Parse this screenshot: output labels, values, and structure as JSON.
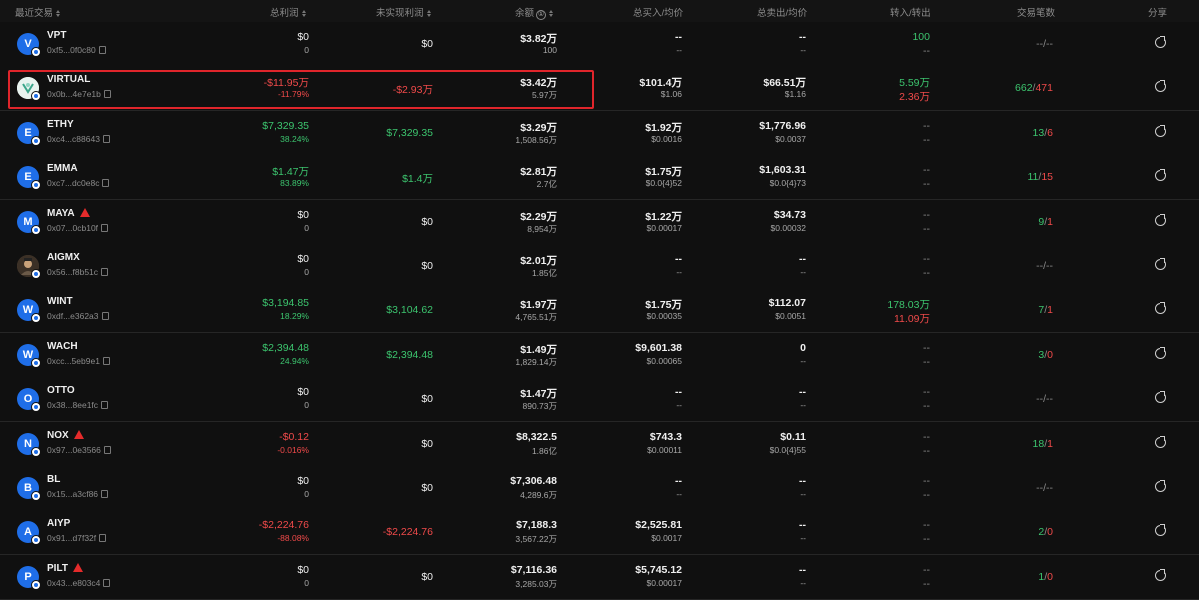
{
  "headers": {
    "recent": "最近交易",
    "total_pnl": "总利润",
    "unrealized": "未实现利润",
    "balance": "余额",
    "buy": "总买入/均价",
    "sell": "总卖出/均价",
    "transfer": "转入/转出",
    "tx_count": "交易笔数",
    "share": "分享"
  },
  "info_glyph": "①",
  "rows": [
    {
      "avatar": "V",
      "avatar_color": "#1f6ee8",
      "name": "VPT",
      "addr": "0xf5...0f0c80",
      "warn": false,
      "pnl": "$0",
      "pnl_pct": "0",
      "pnl_color": "neutral",
      "unreal": "$0",
      "unreal_color": "neutral",
      "bal": "$3.82万",
      "bal_sub": "100",
      "buy": "--",
      "buy_sub": "--",
      "sell": "--",
      "sell_sub": "--",
      "tin": "100",
      "tin_color": "green",
      "tout": "--",
      "tout_color": "dim",
      "tx_a": "--",
      "tx_sep": "/",
      "tx_b": "--",
      "tx_color": "dim"
    },
    {
      "avatar": "",
      "avatar_color": "#e8f3ef",
      "name": "VIRTUAL",
      "addr": "0x0b...4e7e1b",
      "warn": false,
      "pnl": "-$11.95万",
      "pnl_pct": "-11.79%",
      "pnl_color": "red",
      "unreal": "-$2.93万",
      "unreal_color": "red",
      "bal": "$3.42万",
      "bal_sub": "5.97万",
      "buy": "$101.4万",
      "buy_sub": "$1.06",
      "sell": "$66.51万",
      "sell_sub": "$1.16",
      "tin": "5.59万",
      "tin_color": "green",
      "tout": "2.36万",
      "tout_color": "red",
      "tx_a": "662",
      "tx_sep": "/",
      "tx_b": "471",
      "tx_color": "mixed"
    },
    {
      "avatar": "E",
      "avatar_color": "#1f6ee8",
      "name": "ETHY",
      "addr": "0xc4...c88643",
      "warn": false,
      "pnl": "$7,329.35",
      "pnl_pct": "38.24%",
      "pnl_color": "green",
      "unreal": "$7,329.35",
      "unreal_color": "green",
      "bal": "$3.29万",
      "bal_sub": "1,508.56万",
      "buy": "$1.92万",
      "buy_sub": "$0.0016",
      "sell": "$1,776.96",
      "sell_sub": "$0.0037",
      "tin": "--",
      "tin_color": "dim",
      "tout": "--",
      "tout_color": "dim",
      "tx_a": "13",
      "tx_sep": "/",
      "tx_b": "6",
      "tx_color": "mixed"
    },
    {
      "avatar": "E",
      "avatar_color": "#1f6ee8",
      "name": "EMMA",
      "addr": "0xc7...dc0e8c",
      "warn": false,
      "pnl": "$1.47万",
      "pnl_pct": "83.89%",
      "pnl_color": "green",
      "unreal": "$1.4万",
      "unreal_color": "green",
      "bal": "$2.81万",
      "bal_sub": "2.7亿",
      "buy": "$1.75万",
      "buy_sub": "$0.0{4}52",
      "sell": "$1,603.31",
      "sell_sub": "$0.0{4}73",
      "tin": "--",
      "tin_color": "dim",
      "tout": "--",
      "tout_color": "dim",
      "tx_a": "11",
      "tx_sep": "/",
      "tx_b": "15",
      "tx_color": "mixed"
    },
    {
      "avatar": "M",
      "avatar_color": "#1f6ee8",
      "name": "MAYA",
      "addr": "0x07...0cb10f",
      "warn": true,
      "pnl": "$0",
      "pnl_pct": "0",
      "pnl_color": "neutral",
      "unreal": "$0",
      "unreal_color": "neutral",
      "bal": "$2.29万",
      "bal_sub": "8,954万",
      "buy": "$1.22万",
      "buy_sub": "$0.00017",
      "sell": "$34.73",
      "sell_sub": "$0.00032",
      "tin": "--",
      "tin_color": "dim",
      "tout": "--",
      "tout_color": "dim",
      "tx_a": "9",
      "tx_sep": "/",
      "tx_b": "1",
      "tx_color": "mixed"
    },
    {
      "avatar": "",
      "avatar_color": "#5a4a3a",
      "name": "AIGMX",
      "addr": "0x56...f8b51c",
      "warn": false,
      "pnl": "$0",
      "pnl_pct": "0",
      "pnl_color": "neutral",
      "unreal": "$0",
      "unreal_color": "neutral",
      "bal": "$2.01万",
      "bal_sub": "1.85亿",
      "buy": "--",
      "buy_sub": "--",
      "sell": "--",
      "sell_sub": "--",
      "tin": "--",
      "tin_color": "dim",
      "tout": "--",
      "tout_color": "dim",
      "tx_a": "--",
      "tx_sep": "/",
      "tx_b": "--",
      "tx_color": "dim"
    },
    {
      "avatar": "W",
      "avatar_color": "#1f6ee8",
      "name": "WINT",
      "addr": "0xdf...e362a3",
      "warn": false,
      "pnl": "$3,194.85",
      "pnl_pct": "18.29%",
      "pnl_color": "green",
      "unreal": "$3,104.62",
      "unreal_color": "green",
      "bal": "$1.97万",
      "bal_sub": "4,765.51万",
      "buy": "$1.75万",
      "buy_sub": "$0.00035",
      "sell": "$112.07",
      "sell_sub": "$0.0051",
      "tin": "178.03万",
      "tin_color": "green",
      "tout": "11.09万",
      "tout_color": "red",
      "tx_a": "7",
      "tx_sep": "/",
      "tx_b": "1",
      "tx_color": "mixed"
    },
    {
      "avatar": "W",
      "avatar_color": "#1f6ee8",
      "name": "WACH",
      "addr": "0xcc...5eb9e1",
      "warn": false,
      "pnl": "$2,394.48",
      "pnl_pct": "24.94%",
      "pnl_color": "green",
      "unreal": "$2,394.48",
      "unreal_color": "green",
      "bal": "$1.49万",
      "bal_sub": "1,829.14万",
      "buy": "$9,601.38",
      "buy_sub": "$0.00065",
      "sell": "0",
      "sell_sub": "--",
      "tin": "--",
      "tin_color": "dim",
      "tout": "--",
      "tout_color": "dim",
      "tx_a": "3",
      "tx_sep": "/",
      "tx_b": "0",
      "tx_color": "mixed"
    },
    {
      "avatar": "O",
      "avatar_color": "#1f6ee8",
      "name": "OTTO",
      "addr": "0x38...8ee1fc",
      "warn": false,
      "pnl": "$0",
      "pnl_pct": "0",
      "pnl_color": "neutral",
      "unreal": "$0",
      "unreal_color": "neutral",
      "bal": "$1.47万",
      "bal_sub": "890.73万",
      "buy": "--",
      "buy_sub": "--",
      "sell": "--",
      "sell_sub": "--",
      "tin": "--",
      "tin_color": "dim",
      "tout": "--",
      "tout_color": "dim",
      "tx_a": "--",
      "tx_sep": "/",
      "tx_b": "--",
      "tx_color": "dim"
    },
    {
      "avatar": "N",
      "avatar_color": "#1f6ee8",
      "name": "NOX",
      "addr": "0x97...0e3566",
      "warn": true,
      "pnl": "-$0.12",
      "pnl_pct": "-0.016%",
      "pnl_color": "red",
      "unreal": "$0",
      "unreal_color": "neutral",
      "bal": "$8,322.5",
      "bal_sub": "1.86亿",
      "buy": "$743.3",
      "buy_sub": "$0.00011",
      "sell": "$0.11",
      "sell_sub": "$0.0{4}55",
      "tin": "--",
      "tin_color": "dim",
      "tout": "--",
      "tout_color": "dim",
      "tx_a": "18",
      "tx_sep": "/",
      "tx_b": "1",
      "tx_color": "mixed"
    },
    {
      "avatar": "B",
      "avatar_color": "#1f6ee8",
      "name": "BL",
      "addr": "0x15...a3cf86",
      "warn": false,
      "pnl": "$0",
      "pnl_pct": "0",
      "pnl_color": "neutral",
      "unreal": "$0",
      "unreal_color": "neutral",
      "bal": "$7,306.48",
      "bal_sub": "4,289.6万",
      "buy": "--",
      "buy_sub": "--",
      "sell": "--",
      "sell_sub": "--",
      "tin": "--",
      "tin_color": "dim",
      "tout": "--",
      "tout_color": "dim",
      "tx_a": "--",
      "tx_sep": "/",
      "tx_b": "--",
      "tx_color": "dim"
    },
    {
      "avatar": "A",
      "avatar_color": "#1f6ee8",
      "name": "AIYP",
      "addr": "0x91...d7f32f",
      "warn": false,
      "pnl": "-$2,224.76",
      "pnl_pct": "-88.08%",
      "pnl_color": "red",
      "unreal": "-$2,224.76",
      "unreal_color": "red",
      "bal": "$7,188.3",
      "bal_sub": "3,567.22万",
      "buy": "$2,525.81",
      "buy_sub": "$0.0017",
      "sell": "--",
      "sell_sub": "--",
      "tin": "--",
      "tin_color": "dim",
      "tout": "--",
      "tout_color": "dim",
      "tx_a": "2",
      "tx_sep": "/",
      "tx_b": "0",
      "tx_color": "mixed"
    },
    {
      "avatar": "P",
      "avatar_color": "#1f6ee8",
      "name": "PILT",
      "addr": "0x43...e803c4",
      "warn": true,
      "pnl": "$0",
      "pnl_pct": "0",
      "pnl_color": "neutral",
      "unreal": "$0",
      "unreal_color": "neutral",
      "bal": "$7,116.36",
      "bal_sub": "3,285.03万",
      "buy": "$5,745.12",
      "buy_sub": "$0.00017",
      "sell": "--",
      "sell_sub": "--",
      "tin": "--",
      "tin_color": "dim",
      "tout": "--",
      "tout_color": "dim",
      "tx_a": "1",
      "tx_sep": "/",
      "tx_b": "0",
      "tx_color": "mixed"
    }
  ],
  "colors": {
    "green": "#3cc46e",
    "red": "#f04a4a",
    "highlight": "#e0252b",
    "accent": "#1f6ee8"
  }
}
